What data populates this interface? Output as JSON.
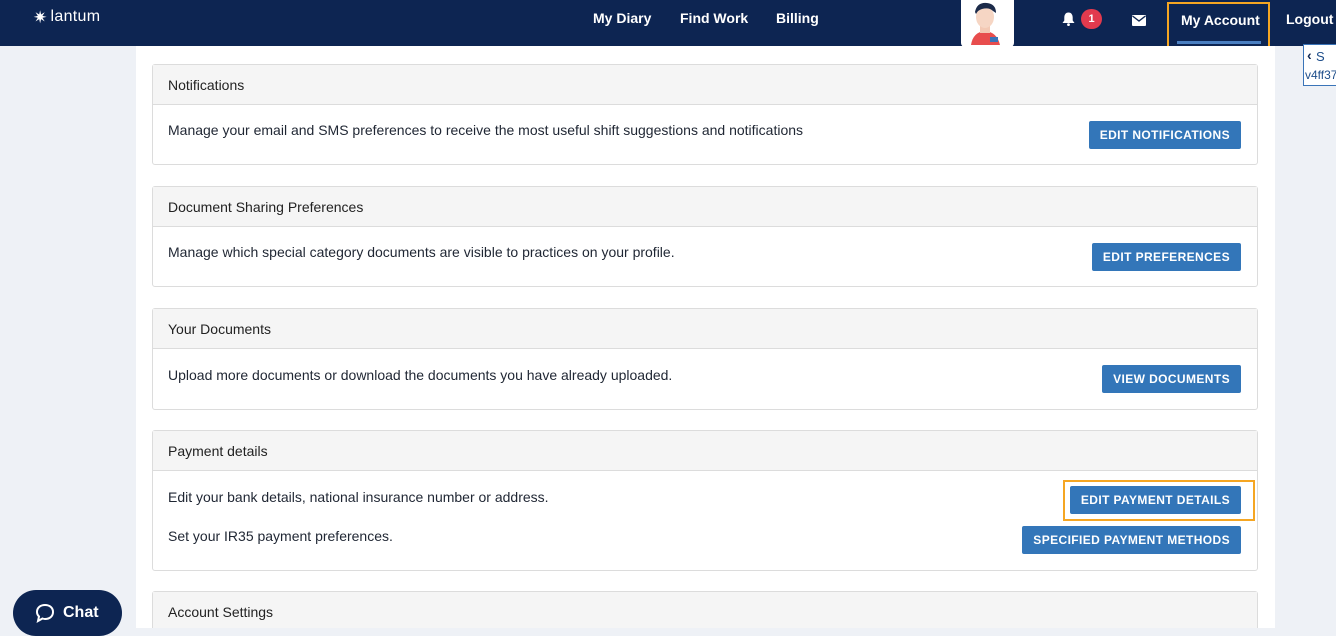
{
  "header": {
    "logo_text": "lantum",
    "nav": [
      "My Diary",
      "Find Work",
      "Billing"
    ],
    "notification_count": "1",
    "my_account": "My Account",
    "logout": "Logout"
  },
  "side_tab": {
    "line1": "S",
    "line2": "v4ff37"
  },
  "sections": [
    {
      "title": "Notifications",
      "rows": [
        {
          "text": "Manage your email and SMS preferences to receive the most useful shift suggestions and notifications",
          "button": "EDIT NOTIFICATIONS"
        }
      ]
    },
    {
      "title": "Document Sharing Preferences",
      "rows": [
        {
          "text": "Manage which special category documents are visible to practices on your profile.",
          "button": "EDIT PREFERENCES"
        }
      ]
    },
    {
      "title": "Your Documents",
      "rows": [
        {
          "text": "Upload more documents or download the documents you have already uploaded.",
          "button": "VIEW DOCUMENTS"
        }
      ]
    },
    {
      "title": "Payment details",
      "rows": [
        {
          "text": "Edit your bank details, national insurance number or address.",
          "button": "EDIT PAYMENT DETAILS"
        },
        {
          "text": "Set your IR35 payment preferences.",
          "button": "SPECIFIED PAYMENT METHODS"
        }
      ]
    },
    {
      "title": "Account Settings",
      "rows": []
    }
  ],
  "chat_label": "Chat",
  "colors": {
    "nav_bg": "#0d2552",
    "button_bg": "#3376b9",
    "highlight": "#f5a623",
    "badge": "#e23a4e"
  }
}
